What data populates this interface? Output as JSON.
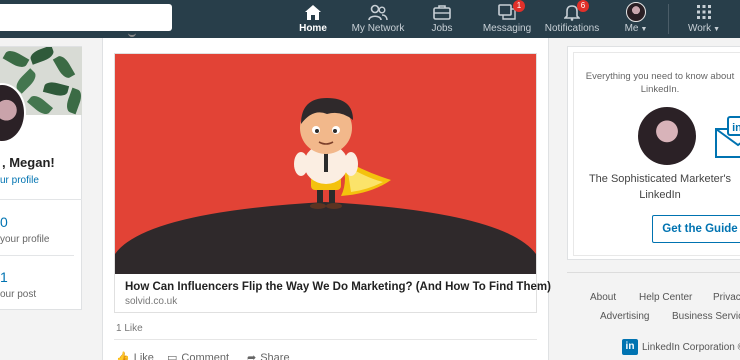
{
  "nav": {
    "search_value": "",
    "items": [
      {
        "label": "Home",
        "icon": "home-icon",
        "active": true
      },
      {
        "label": "My Network",
        "icon": "network-icon"
      },
      {
        "label": "Jobs",
        "icon": "briefcase-icon"
      },
      {
        "label": "Messaging",
        "icon": "messaging-icon",
        "badge": "1"
      },
      {
        "label": "Notifications",
        "icon": "bell-icon",
        "badge": "6"
      },
      {
        "label": "Me",
        "icon": "avatar"
      },
      {
        "label": "Work",
        "icon": "grid-icon"
      }
    ]
  },
  "profile": {
    "greeting": ", Megan!",
    "view_profile": "ur profile",
    "stats": [
      {
        "number": "0",
        "label": "your profile"
      },
      {
        "number": "1",
        "label": "our post"
      }
    ]
  },
  "post": {
    "link_title": "How Can Influencers Flip the Way We Do Marketing? (And How To Find Them)",
    "link_domain": "solvid.co.uk",
    "likes": "1 Like",
    "actions": [
      {
        "label": "Like",
        "icon": "thumbs-up-icon"
      },
      {
        "label": "Comment",
        "icon": "comment-icon"
      },
      {
        "label": "Share",
        "icon": "share-icon"
      }
    ]
  },
  "ad": {
    "headline_line1": "Everything you need to know about",
    "headline_line2": "LinkedIn.",
    "subtitle_line1": "The Sophisticated Marketer's",
    "subtitle_line2": "LinkedIn",
    "cta": "Get the Guide"
  },
  "footer": {
    "links": [
      "About",
      "Help Center",
      "Privacy",
      "Advertising",
      "Business Services"
    ],
    "logo_text": "in",
    "corp": "LinkedIn Corporation ©"
  },
  "colors": {
    "nav_bg": "#283e4a",
    "accent": "#0073b1",
    "hero_bg": "#e24336",
    "badge": "#e1302a"
  }
}
